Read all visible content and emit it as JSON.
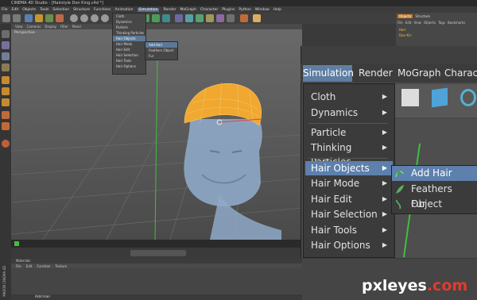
{
  "app": {
    "title": "CINEMA 4D Studio - [Hairstyle Don King.c4d *]"
  },
  "menubar": [
    "File",
    "Edit",
    "Objects",
    "Tools",
    "Selection",
    "Structure",
    "Functions",
    "Animation",
    "Simulation",
    "Render",
    "MoGraph",
    "Character",
    "Plugins",
    "Python",
    "Window",
    "Help"
  ],
  "active_menu": "Simulation",
  "viewport": {
    "label": "Perspective",
    "menu": [
      "View",
      "Cameras",
      "Display",
      "Filter",
      "Panel"
    ]
  },
  "small_menu": {
    "items": [
      "Cloth",
      "Dynamics",
      "Particle",
      "Thinking Particles",
      "Hair Objects",
      "Hair Mode",
      "Hair Edit",
      "Hair Selection",
      "Hair Tools",
      "Hair Options"
    ],
    "sub_items": [
      "Add Hair",
      "Feathers Object",
      "Fur"
    ]
  },
  "object_manager": {
    "tabs": [
      "Objects",
      "Structure"
    ],
    "menu": [
      "File",
      "Edit",
      "View",
      "Objects",
      "Tags",
      "Bookmarks"
    ],
    "rows": [
      "Hair",
      "Don Kin"
    ]
  },
  "material": {
    "title": "Materials",
    "menu": [
      "File",
      "Edit",
      "Function",
      "Texture"
    ]
  },
  "status": {
    "text": "Add Hair",
    "brand": "MAXON CINEMA 4D"
  },
  "zoom": {
    "menubar": [
      "Simulation",
      "Render",
      "MoGraph",
      "Characte"
    ],
    "items": [
      {
        "label": "Cloth",
        "arrow": true
      },
      {
        "label": "Dynamics",
        "arrow": true
      },
      {
        "label": "Particle",
        "arrow": true
      },
      {
        "label": "Thinking Particles",
        "arrow": true
      },
      {
        "label": "Hair Objects",
        "arrow": true
      },
      {
        "label": "Hair Mode",
        "arrow": true
      },
      {
        "label": "Hair Edit",
        "arrow": true
      },
      {
        "label": "Hair Selection",
        "arrow": true
      },
      {
        "label": "Hair Tools",
        "arrow": true
      },
      {
        "label": "Hair Options",
        "arrow": true
      }
    ],
    "sub_items": [
      {
        "label": "Add Hair",
        "icon": "add-hair-icon"
      },
      {
        "label": "Feathers Object",
        "icon": "feather-icon"
      },
      {
        "label": "Fur",
        "icon": "fur-icon"
      }
    ]
  },
  "watermark": {
    "text": "pxleyes",
    "suffix": ".com"
  },
  "colors": {
    "highlight": "#5d80ac",
    "hair": "#f0a830",
    "head": "#8fa9c8"
  }
}
